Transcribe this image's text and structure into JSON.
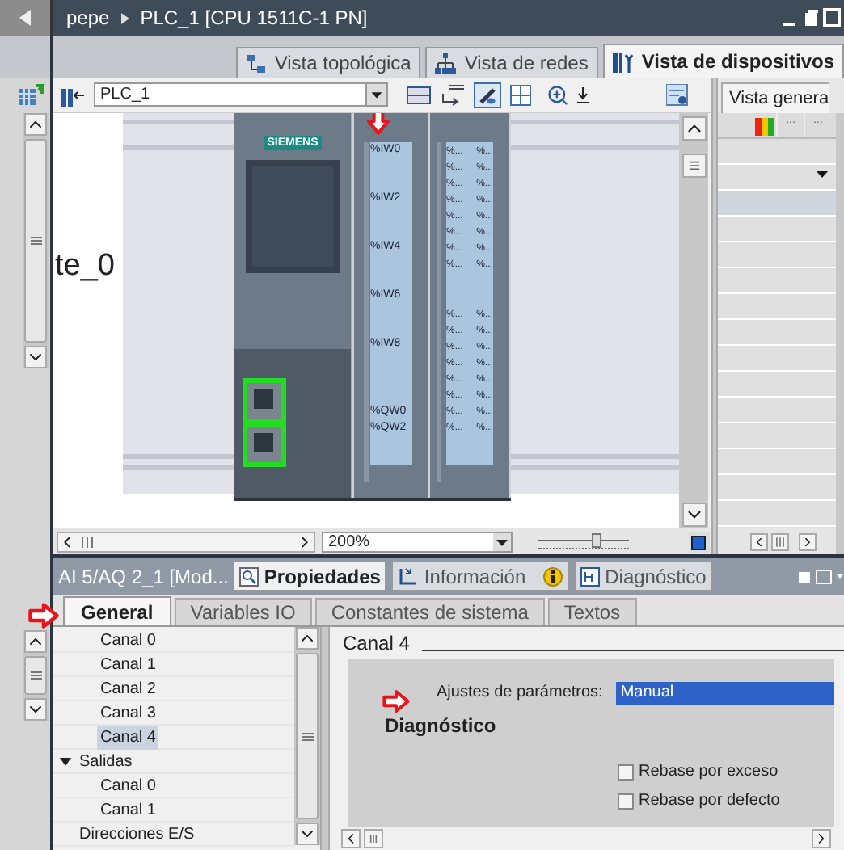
{
  "title_bar": {
    "breadcrumb": [
      "pepe",
      "PLC_1 [CPU 1511C-1 PN]"
    ]
  },
  "view_tabs": [
    {
      "label": "Vista topológica",
      "selected": false,
      "kind": "topology"
    },
    {
      "label": "Vista de redes",
      "selected": false,
      "kind": "network"
    },
    {
      "label": "Vista de dispositivos",
      "selected": true,
      "kind": "device"
    }
  ],
  "toolbar": {
    "device_select": "PLC_1"
  },
  "canvas": {
    "station_label": "te_0",
    "cpu": {
      "brand": "SIEMENS"
    },
    "io_module": {
      "inputs": [
        "%IW0",
        "%IW2",
        "%IW4",
        "%IW6",
        "%IW8"
      ],
      "outputs": [
        "%QW0",
        "%QW2"
      ]
    },
    "di_module": {
      "groups": [
        [
          [
            "%...",
            "%..."
          ],
          [
            "%...",
            "%..."
          ],
          [
            "%...",
            "%..."
          ],
          [
            "%...",
            "%..."
          ],
          [
            "%...",
            "%..."
          ],
          [
            "%...",
            "%..."
          ],
          [
            "%...",
            "%..."
          ],
          [
            "%...",
            "%..."
          ]
        ],
        [
          [
            "%...",
            "%..."
          ],
          [
            "%...",
            "%..."
          ],
          [
            "%...",
            "%..."
          ],
          [
            "%...",
            "%..."
          ],
          [
            "%...",
            "%..."
          ],
          [
            "%...",
            "%..."
          ],
          [
            "%...",
            "%..."
          ],
          [
            "%...",
            "%..."
          ]
        ]
      ]
    }
  },
  "zoom": {
    "value": "200%",
    "level": 0.65
  },
  "overview": {
    "tab": "Vista genera",
    "columns": [
      "...",
      "..."
    ]
  },
  "inspector": {
    "title": "AI 5/AQ 2_1 [Mod...",
    "tabs": [
      {
        "label": "Propiedades",
        "selected": true,
        "kind": "properties"
      },
      {
        "label": "Información",
        "selected": false,
        "kind": "info"
      },
      {
        "label": "Diagnóstico",
        "selected": false,
        "kind": "diagnostics"
      }
    ],
    "subtabs": [
      {
        "label": "General",
        "selected": true
      },
      {
        "label": "Variables IO",
        "selected": false
      },
      {
        "label": "Constantes de sistema",
        "selected": false
      },
      {
        "label": "Textos",
        "selected": false
      }
    ],
    "tree": {
      "continued": [
        {
          "label": "Canal 0",
          "selected": false
        },
        {
          "label": "Canal 1",
          "selected": false
        },
        {
          "label": "Canal 2",
          "selected": false
        },
        {
          "label": "Canal 3",
          "selected": false
        },
        {
          "label": "Canal 4",
          "selected": true
        }
      ],
      "items": [
        {
          "label": "Salidas",
          "expanded": true,
          "selected": false,
          "children": [
            {
              "label": "Canal 0",
              "selected": false
            },
            {
              "label": "Canal 1",
              "selected": false
            }
          ]
        },
        {
          "label": "Direcciones E/S",
          "selected": false
        }
      ]
    },
    "content": {
      "heading": "Canal 4",
      "param_label": "Ajustes de parámetros:",
      "param_value": "Manual",
      "section": "Diagnóstico",
      "checks": [
        {
          "label": "Rebase por exceso",
          "checked": false
        },
        {
          "label": "Rebase por defecto",
          "checked": false
        }
      ]
    }
  }
}
